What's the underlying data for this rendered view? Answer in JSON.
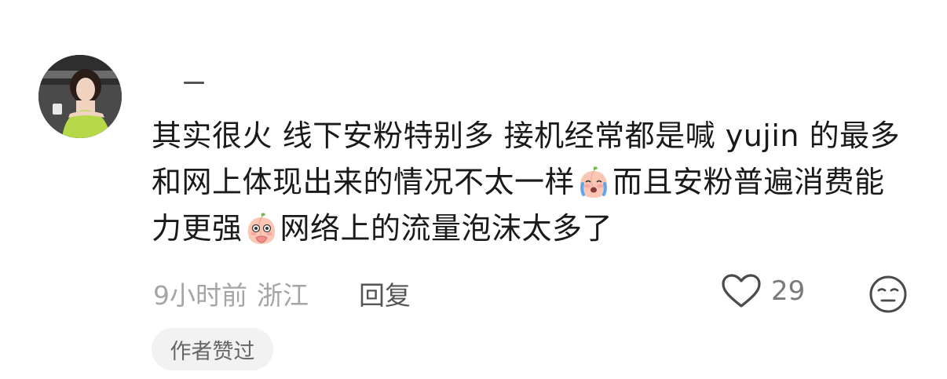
{
  "comment": {
    "username": "一",
    "text_parts": [
      "其实很火 线下安粉特别多 接机经常都是喊 yujin 的最多 和网上体现出来的情况不太一样",
      "而且安粉普遍消费能力更强",
      "网络上的流量泡沫太多了"
    ],
    "emojis": [
      "crying-peach-emoji",
      "shy-peach-emoji"
    ],
    "time": "9小时前",
    "location": "浙江",
    "reply_label": "回复",
    "like_count": "29",
    "author_badge": "作者赞过"
  },
  "colors": {
    "text": "#1a1a1a",
    "meta": "#a5a5a5",
    "badge_bg": "#f2f2f2"
  }
}
